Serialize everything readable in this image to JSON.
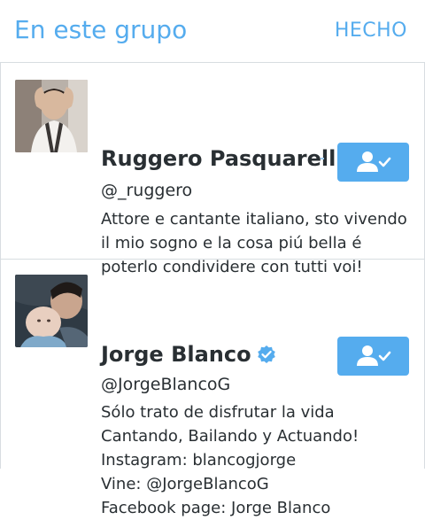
{
  "header": {
    "title": "En este grupo",
    "done_label": "HECHO"
  },
  "colors": {
    "accent": "#55acee",
    "text": "#292f33",
    "divider": "#d8dde1"
  },
  "users": [
    {
      "name": "Ruggero Pasquarelli",
      "handle": "@_ruggero",
      "verified": false,
      "bio": "Attore e cantante italiano, sto vivendo il mio sogno e la cosa piú bella é poterlo condividere con tutti voi!",
      "follow_icon": "following-user-check-icon"
    },
    {
      "name": "Jorge Blanco",
      "handle": "@JorgeBlancoG",
      "verified": true,
      "bio_lines": [
        "Sólo trato de disfrutar la vida",
        "Cantando, Bailando y Actuando!",
        "Instagram: blancogjorge",
        "Vine: @JorgeBlancoG",
        "Facebook page: Jorge Blanco"
      ],
      "follow_icon": "following-user-check-icon"
    }
  ]
}
